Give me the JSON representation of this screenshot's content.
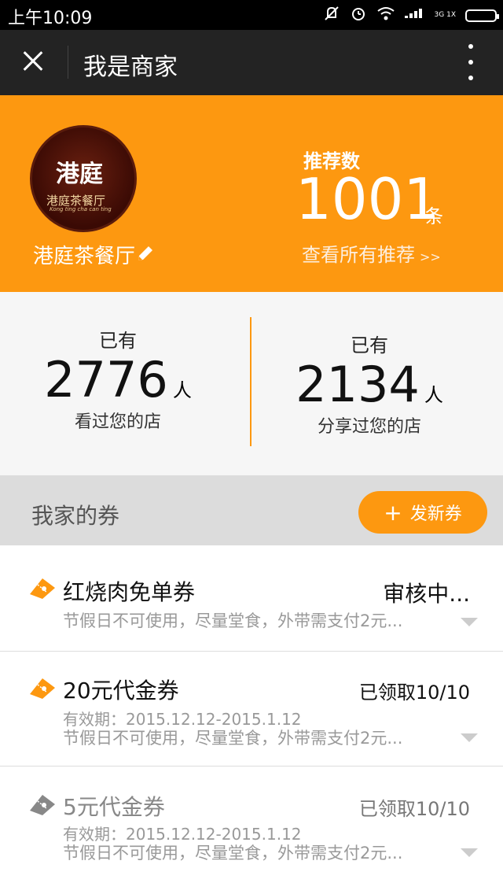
{
  "statusbar": {
    "time": "上午10:09",
    "network": "3G 1X"
  },
  "titlebar": {
    "title": "我是商家"
  },
  "shop": {
    "logo_main": "港庭",
    "logo_sub": "港庭茶餐厅",
    "logo_pinyin": "Kong ting cha can ting",
    "name": "港庭茶餐厅"
  },
  "recommend": {
    "label": "推荐数",
    "count": "1001",
    "unit": "条",
    "link": "查看所有推荐",
    "link_arrows": ">>"
  },
  "stats": {
    "viewed": {
      "pre": "已有",
      "count": "2776",
      "unit": "人",
      "post": "看过您的店"
    },
    "shared": {
      "pre": "已有",
      "count": "2134",
      "unit": "人",
      "post": "分享过您的店"
    }
  },
  "coupons_section": {
    "title": "我家的券",
    "new_button": "发新券"
  },
  "coupons": [
    {
      "name": "红烧肉免单券",
      "status": "审核中...",
      "validity": "",
      "note": "节假日不可使用，尽量堂食，外带需支付2元...",
      "color": "#fd9810"
    },
    {
      "name": "20元代金券",
      "status": "已领取10/10",
      "validity": "有效期：2015.12.12-2015.1.12",
      "note": "节假日不可使用，尽量堂食，外带需支付2元...",
      "color": "#fd9810"
    },
    {
      "name": "5元代金券",
      "status": "已领取10/10",
      "validity": "有效期：2015.12.12-2015.1.12",
      "note": "节假日不可使用，尽量堂食，外带需支付2元...",
      "color": "#888888"
    }
  ],
  "colors": {
    "accent": "#fd9810",
    "titlebar": "#232323"
  }
}
